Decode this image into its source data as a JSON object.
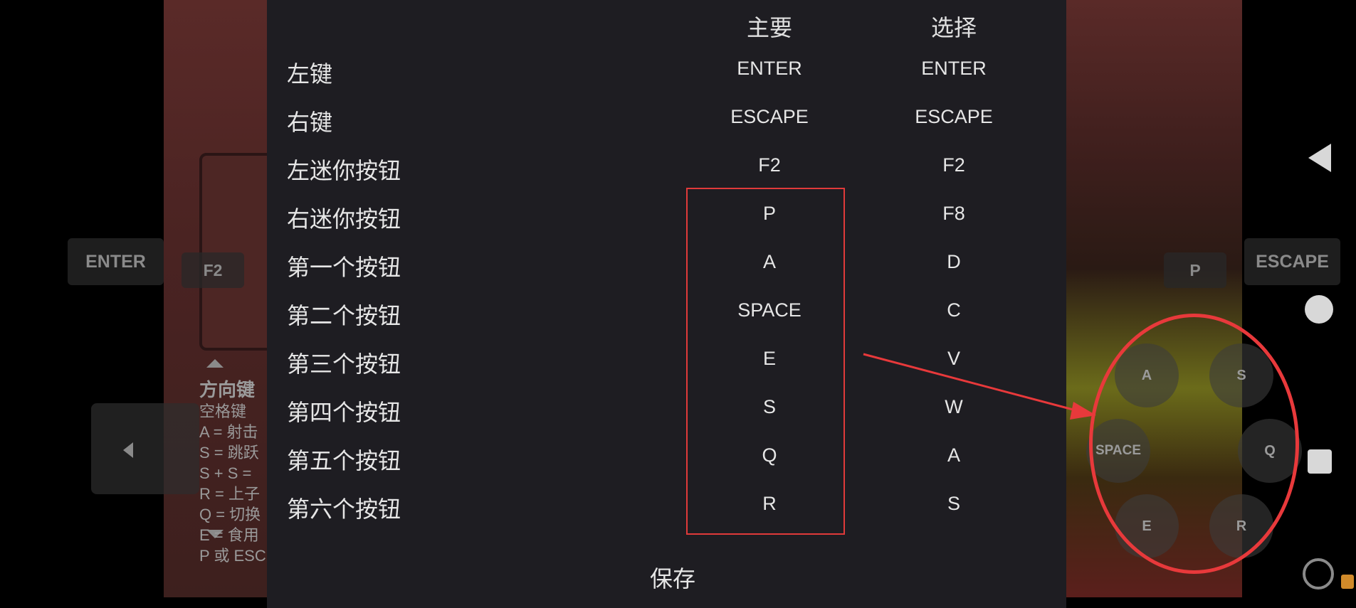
{
  "background": {
    "left_buttons": {
      "enter": "ENTER",
      "f2": "F2"
    },
    "right_buttons": {
      "p": "P",
      "escape": "ESCAPE"
    },
    "action_buttons": [
      "A",
      "S",
      "SPACE",
      "Q",
      "E",
      "R"
    ],
    "help_text": {
      "title": "方向键",
      "lines": [
        "空格键",
        "A = 射击",
        "S = 跳跃",
        "S + S =",
        "R = 上子",
        "Q = 切换",
        "E = 食用",
        "P 或 ESC"
      ]
    }
  },
  "dialog": {
    "headers": {
      "primary": "主要",
      "secondary": "选择"
    },
    "rows": [
      {
        "label": "左键",
        "primary": "ENTER",
        "secondary": "ENTER"
      },
      {
        "label": "右键",
        "primary": "ESCAPE",
        "secondary": "ESCAPE"
      },
      {
        "label": "左迷你按钮",
        "primary": "F2",
        "secondary": "F2"
      },
      {
        "label": "右迷你按钮",
        "primary": "P",
        "secondary": "F8"
      },
      {
        "label": "第一个按钮",
        "primary": "A",
        "secondary": "D"
      },
      {
        "label": "第二个按钮",
        "primary": "SPACE",
        "secondary": "C"
      },
      {
        "label": "第三个按钮",
        "primary": "E",
        "secondary": "V"
      },
      {
        "label": "第四个按钮",
        "primary": "S",
        "secondary": "W"
      },
      {
        "label": "第五个按钮",
        "primary": "Q",
        "secondary": "A"
      },
      {
        "label": "第六个按钮",
        "primary": "R",
        "secondary": "S"
      }
    ],
    "save_label": "保存"
  },
  "sidebar": {
    "icons": [
      "back-icon",
      "home-icon",
      "recents-icon",
      "rotate-icon"
    ]
  },
  "annotation_color": "#e8393b"
}
